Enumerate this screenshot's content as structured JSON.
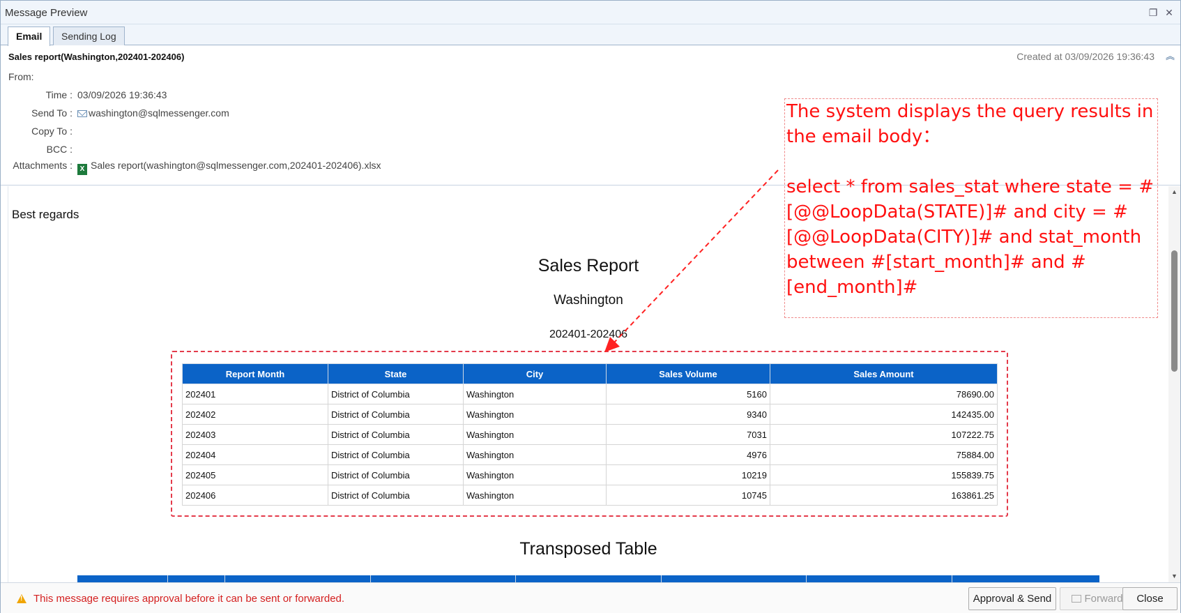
{
  "window": {
    "title": "Message Preview",
    "restore_icon": "restore-icon",
    "close_icon": "close-icon"
  },
  "tabs": [
    {
      "label": "Email",
      "active": true
    },
    {
      "label": "Sending Log",
      "active": false
    }
  ],
  "header": {
    "subject": "Sales report(Washington,202401-202406)",
    "created": "Created at 03/09/2026 19:36:43",
    "from_label": "From:",
    "time_label": "Time :",
    "time_value": "03/09/2026 19:36:43",
    "sendto_label": "Send To :",
    "sendto_value": "washington@sqlmessenger.com",
    "copyto_label": "Copy To :",
    "copyto_value": "",
    "bcc_label": "BCC :",
    "bcc_value": "",
    "attachments_label": "Attachments :",
    "attachment_name": "Sales report(washington@sqlmessenger.com,202401-202406).xlsx"
  },
  "body": {
    "regards": "Best regards",
    "report_title": "Sales Report",
    "city": "Washington",
    "period": "202401-202406",
    "transposed_title": "Transposed Table"
  },
  "table": {
    "columns": [
      "Report Month",
      "State",
      "City",
      "Sales Volume",
      "Sales Amount"
    ],
    "rows": [
      [
        "202401",
        "District of Columbia",
        "Washington",
        "5160",
        "78690.00"
      ],
      [
        "202402",
        "District of Columbia",
        "Washington",
        "9340",
        "142435.00"
      ],
      [
        "202403",
        "District of Columbia",
        "Washington",
        "7031",
        "107222.75"
      ],
      [
        "202404",
        "District of Columbia",
        "Washington",
        "4976",
        "75884.00"
      ],
      [
        "202405",
        "District of Columbia",
        "Washington",
        "10219",
        "155839.75"
      ],
      [
        "202406",
        "District of Columbia",
        "Washington",
        "10745",
        "163861.25"
      ]
    ]
  },
  "annotation": {
    "line1": "The system displays the query results in the email body：",
    "line2": "select * from sales_stat where state = #[@@LoopData(STATE)]# and city = #[@@LoopData(CITY)]# and stat_month between #[start_month]# and #[end_month]#"
  },
  "footer": {
    "warning": "This message requires approval before it can be sent or forwarded.",
    "approve_label": "Approval & Send",
    "forward_label": "Forward",
    "close_label": "Close"
  },
  "colors": {
    "table_header": "#0b63c7",
    "annotation": "#ff1010",
    "warning_text": "#d42020",
    "dash_box": "#e43a4a"
  }
}
